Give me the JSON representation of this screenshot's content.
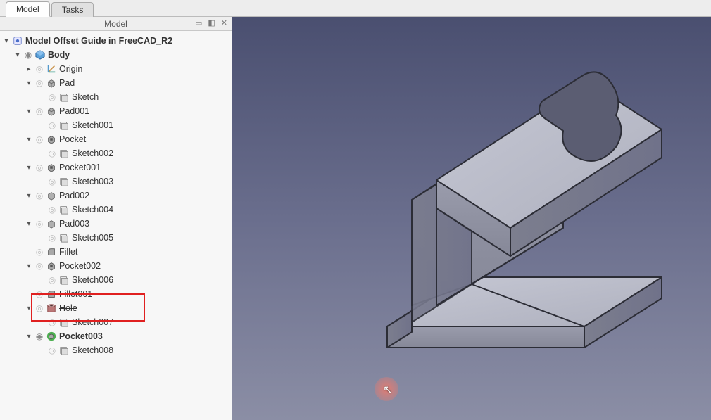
{
  "tabs": {
    "model": "Model",
    "tasks": "Tasks",
    "active": "model"
  },
  "panel": {
    "title": "Model"
  },
  "tree": {
    "root": {
      "label": "Model Offset Guide in FreeCAD_R2"
    },
    "body": {
      "label": "Body"
    },
    "origin": {
      "label": "Origin"
    },
    "pad": {
      "label": "Pad",
      "sketch": "Sketch"
    },
    "pad001": {
      "label": "Pad001",
      "sketch": "Sketch001"
    },
    "pocket": {
      "label": "Pocket",
      "sketch": "Sketch002"
    },
    "pocket001": {
      "label": "Pocket001",
      "sketch": "Sketch003"
    },
    "pad002": {
      "label": "Pad002",
      "sketch": "Sketch004"
    },
    "pad003": {
      "label": "Pad003",
      "sketch": "Sketch005"
    },
    "fillet": {
      "label": "Fillet"
    },
    "pocket002": {
      "label": "Pocket002",
      "sketch": "Sketch006"
    },
    "fillet001": {
      "label": "Fillet001"
    },
    "hole": {
      "label": "Hole",
      "sketch": "Sketch007"
    },
    "pocket003": {
      "label": "Pocket003",
      "sketch": "Sketch008"
    }
  }
}
